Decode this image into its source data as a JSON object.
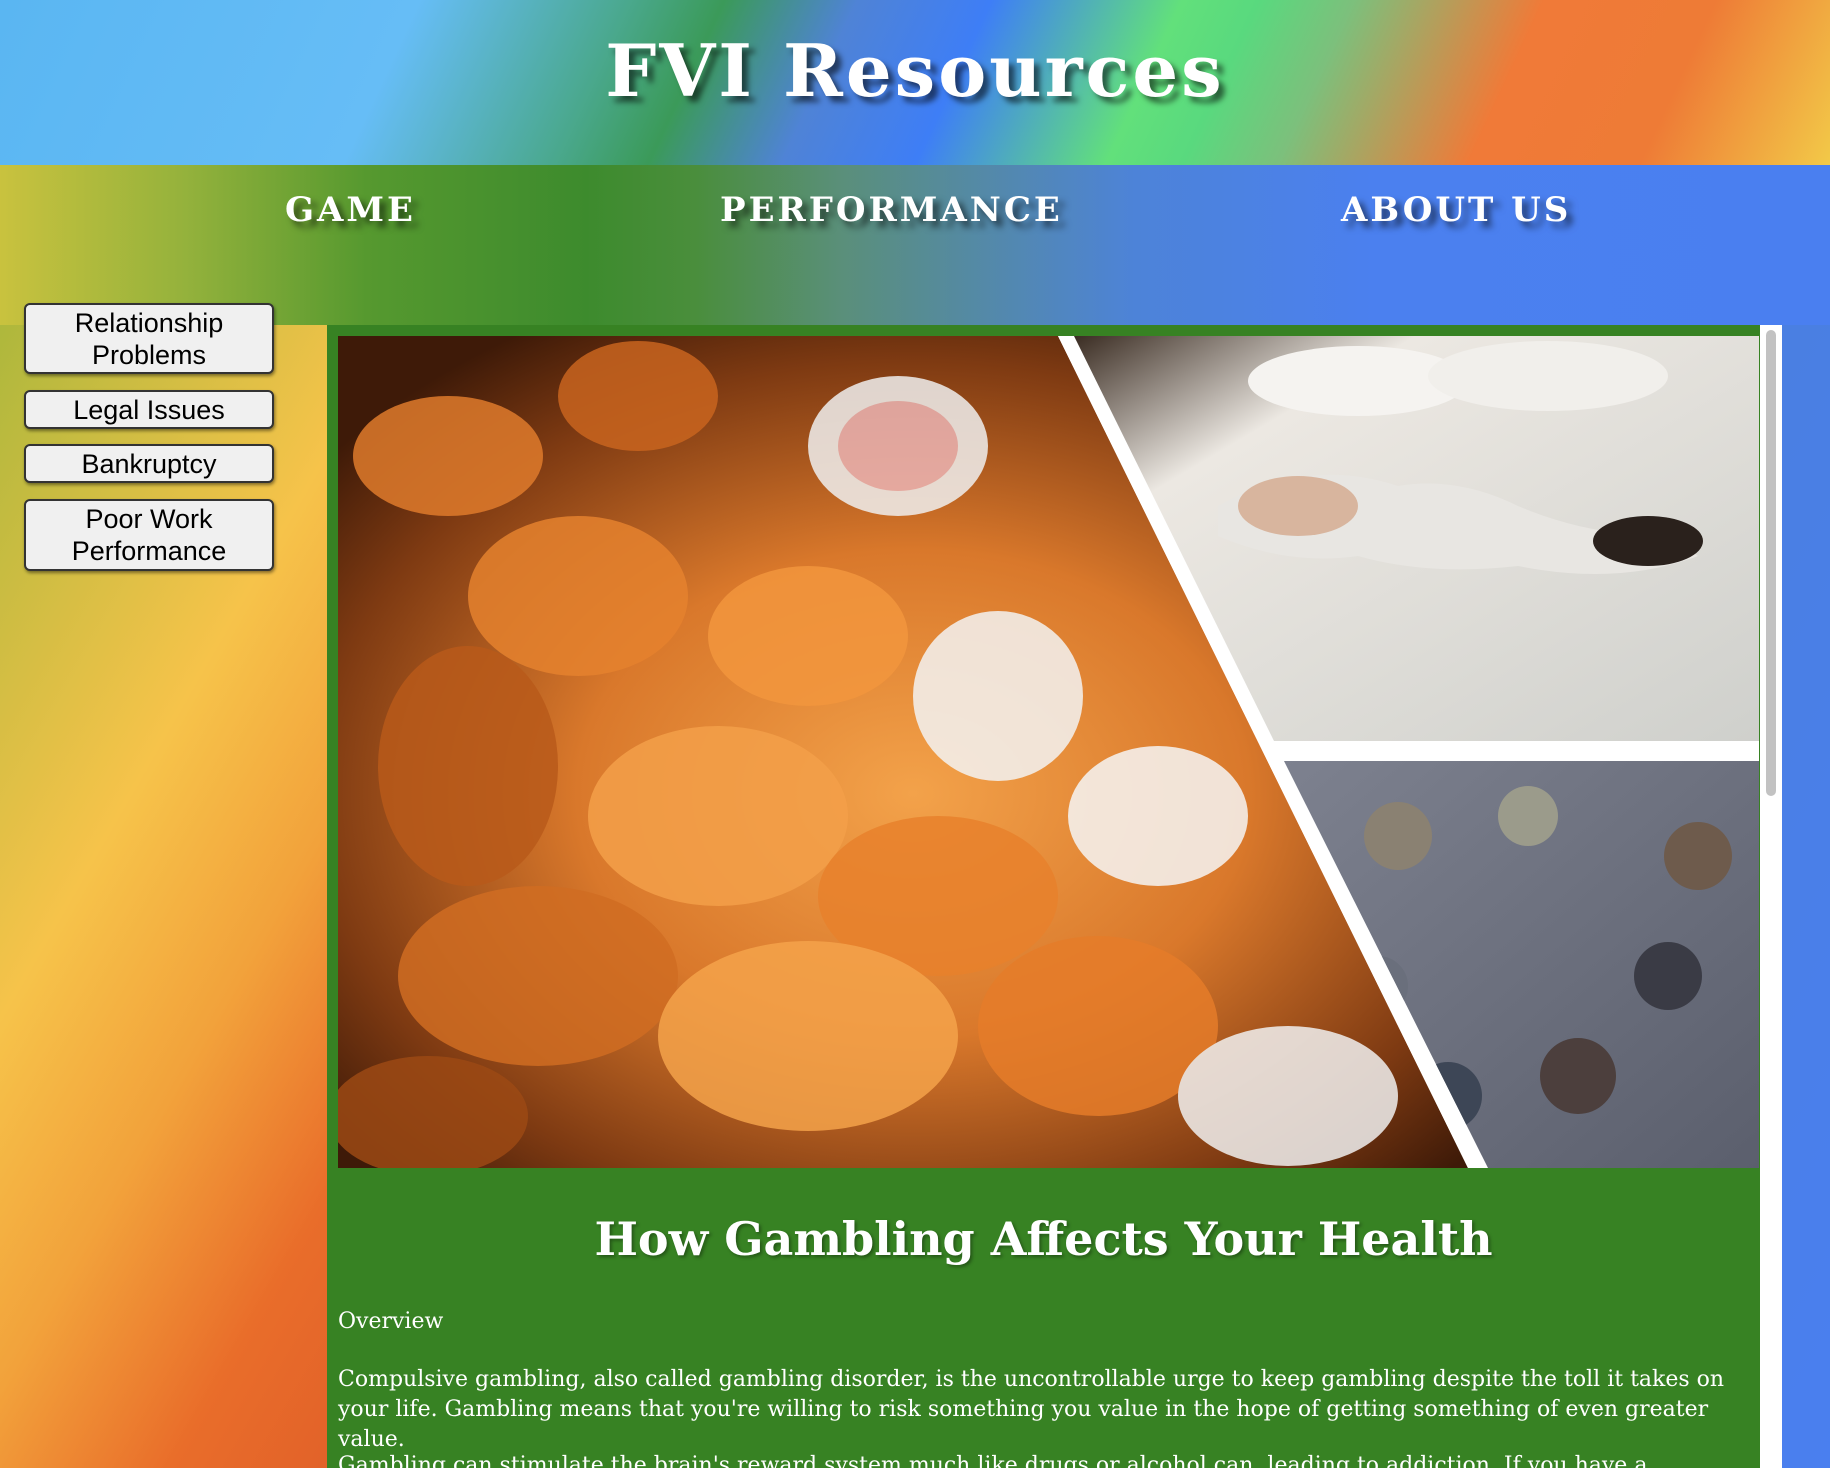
{
  "site": {
    "title": "FVI Resources"
  },
  "nav": {
    "items": [
      {
        "label": "GAME"
      },
      {
        "label": "PERFORMANCE"
      },
      {
        "label": "ABOUT US"
      }
    ]
  },
  "sidebar": {
    "buttons": [
      {
        "label": "Relationship Problems"
      },
      {
        "label": "Legal Issues"
      },
      {
        "label": "Bankruptcy"
      },
      {
        "label": "Poor Work Performance"
      }
    ]
  },
  "main": {
    "title": "How Gambling Affects Your Health",
    "overview_label": "Overview",
    "paragraph_1": "Compulsive gambling, also called gambling disorder, is the uncontrollable urge to keep gambling despite the toll it takes on your life. Gambling means that you're willing to risk something you value in the hope of getting something of even greater value.",
    "paragraph_2": "Gambling can stimulate the brain's reward system much like drugs or alcohol can, leading to addiction. If you have a problem with"
  },
  "colors": {
    "content_panel": "#378223",
    "button_bg": "#f0f0f0",
    "text_light": "#ffffff"
  },
  "icons": {
    "hero": "collage-image"
  }
}
